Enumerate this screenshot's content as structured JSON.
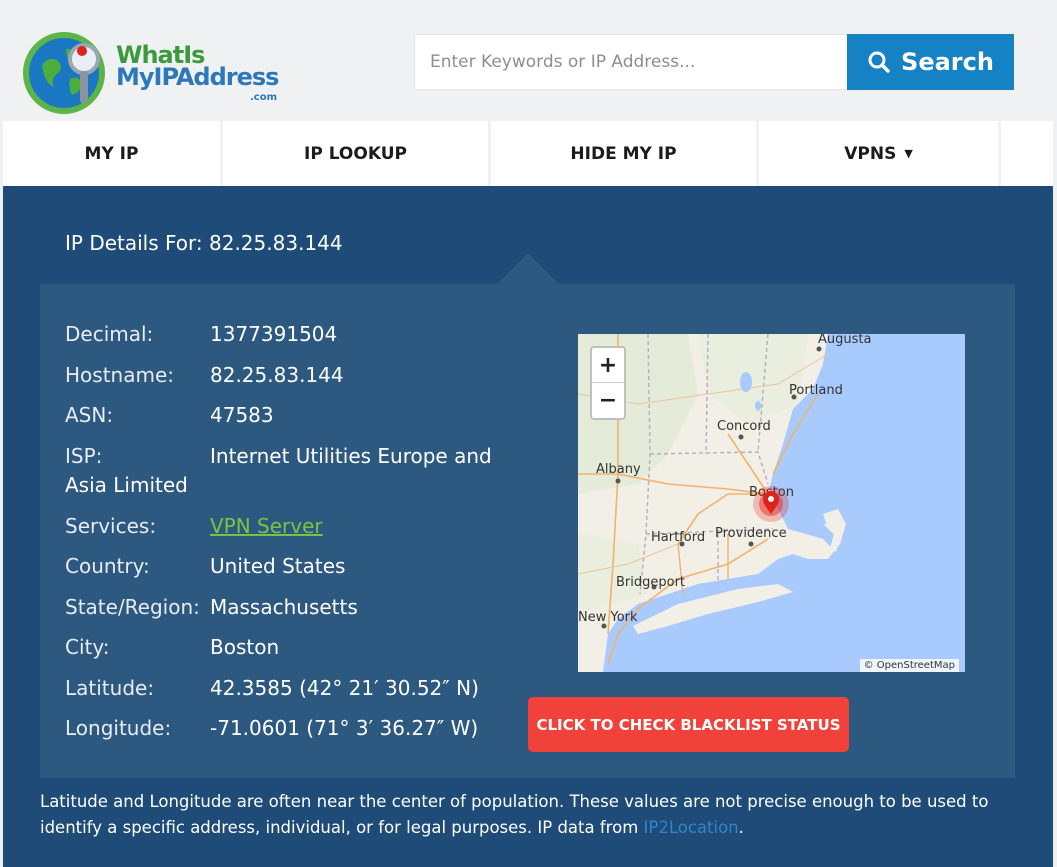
{
  "header": {
    "logo": {
      "line1": "WhatIs",
      "line2": "MyIPAddress",
      "suffix": ".com"
    },
    "search_placeholder": "Enter Keywords or IP Address...",
    "search_button": "Search"
  },
  "nav": {
    "items": [
      {
        "label": "MY IP"
      },
      {
        "label": "IP LOOKUP"
      },
      {
        "label": "HIDE MY IP"
      },
      {
        "label": "VPNS",
        "has_caret": true
      }
    ],
    "caret": "▼"
  },
  "details": {
    "title": "IP Details For: 82.25.83.144",
    "rows": [
      {
        "key": "Decimal:",
        "value": "1377391504"
      },
      {
        "key": "Hostname:",
        "value": "82.25.83.144"
      },
      {
        "key": "ASN:",
        "value": "47583"
      },
      {
        "key": "ISP:",
        "value": "Internet Utilities Europe and",
        "value2": "Asia Limited"
      },
      {
        "key": "Services:",
        "value": "VPN Server"
      },
      {
        "key": "Country:",
        "value": "United States"
      },
      {
        "key": "State/Region:",
        "value": "Massachusetts"
      },
      {
        "key": "City:",
        "value": "Boston"
      },
      {
        "key": "Latitude:",
        "value": "42.3585 (42° 21′ 30.52″ N)"
      },
      {
        "key": "Longitude:",
        "value": "-71.0601 (71° 3′ 36.27″ W)"
      }
    ]
  },
  "map": {
    "zoom_in": "+",
    "zoom_out": "−",
    "attribution": "© OpenStreetMap",
    "labels": {
      "augusta": "Augusta",
      "portland": "Portland",
      "concord": "Concord",
      "albany": "Albany",
      "boston": "Boston",
      "hartford": "Hartford",
      "providence": "Providence",
      "bridgeport": "Bridgeport",
      "new_york": "New York"
    },
    "colors": {
      "water": "#a9cafd",
      "land": "#f2efe6",
      "marker": "#e2211c"
    }
  },
  "blacklist_button": "CLICK TO CHECK BLACKLIST STATUS",
  "footnote": {
    "text": "Latitude and Longitude are often near the center of population. These values are not precise enough to be used to identify a specific address, individual, or for legal purposes. IP data from ",
    "link": "IP2Location",
    "end": "."
  },
  "colors": {
    "brand_blue": "#1482c5",
    "panel_dark": "#1e4b77",
    "panel_inner": "#2d5980",
    "accent_red": "#f0413a",
    "link_green": "#7cc242"
  }
}
